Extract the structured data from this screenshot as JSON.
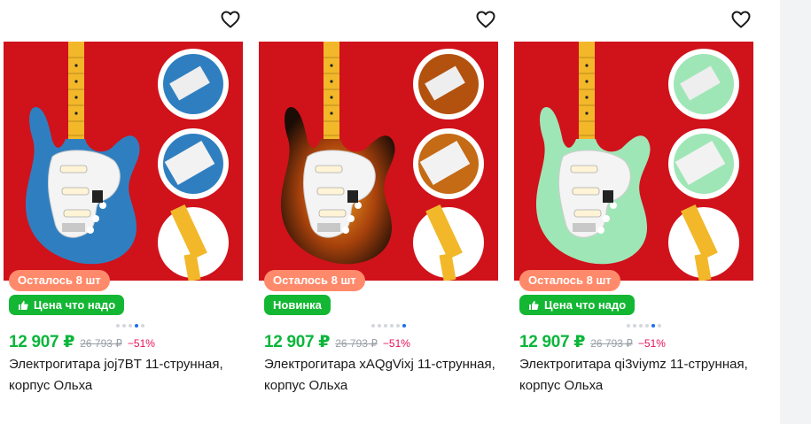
{
  "products": [
    {
      "stock_label": "Осталось 8 шт",
      "promo_label": "Цена что надо",
      "promo_icon": "thumbs-up-icon",
      "price": "12 907 ₽",
      "old_price": "26 793 ₽",
      "discount": "−51%",
      "title": "Электрогитара joj7BT 11-струнная, корпус Ольха",
      "gallery_active_index": 3,
      "body_color": "#2f7fc0",
      "favorite_icon": "heart-outline-icon"
    },
    {
      "stock_label": "Осталось 8 шт",
      "promo_label": "Новинка",
      "price": "12 907 ₽",
      "old_price": "26 793 ₽",
      "discount": "−51%",
      "title": "Электрогитара xAQgVixj 11-струнная, корпус Ольха",
      "gallery_active_index": 5,
      "body_color": "sunburst",
      "favorite_icon": "heart-outline-icon"
    },
    {
      "stock_label": "Осталось 8 шт",
      "promo_label": "Цена что надо",
      "promo_icon": "thumbs-up-icon",
      "price": "12 907 ₽",
      "old_price": "26 793 ₽",
      "discount": "−51%",
      "title": "Электрогитара qi3viymz 11-струнная, корпус Ольха",
      "gallery_active_index": 4,
      "body_color": "#9fe6b7",
      "favorite_icon": "heart-outline-icon"
    }
  ],
  "colors": {
    "price": "#0bb63b",
    "discount": "#e6115b",
    "stock_badge": "#ff8a6b",
    "promo_badge": "#14b733",
    "photo_bg": "#d0121b"
  }
}
